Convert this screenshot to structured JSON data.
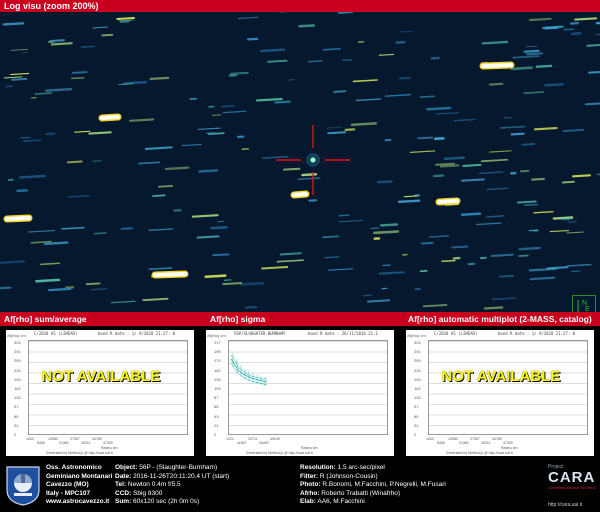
{
  "top_bar": {
    "title": "Log visu (zoom 200%)"
  },
  "compass": {
    "north_label": "N",
    "east_label": "E"
  },
  "panels": [
    {
      "title": "Af[rho] sum/average",
      "header": [
        "C/2018 A5 (LINEAR)",
        "band R  date : 1/ 9/2018 21:27: 0"
      ],
      "ylabel": "Af(rho) cm",
      "yticks": [
        "324",
        "291",
        "259",
        "226",
        "194",
        "162",
        "129",
        "97",
        "65",
        "32",
        "0"
      ],
      "xticks": [
        "1542",
        "8406",
        "15983",
        "21384",
        "27507",
        "34311",
        "40789",
        "47309"
      ],
      "xtitle": "Radius km",
      "generated": "Generated by Mefitrol(r) @ http://cara.uai.it",
      "status": "NOT AVAILABLE"
    },
    {
      "title": "Af[rho] sigma",
      "header": [
        "56P/SLAUGHTER-BURNHAM",
        "band R  date : 26/11/2016 21:1"
      ],
      "ylabel": "Af(rho) cm",
      "yticks": [
        "217",
        "195",
        "174",
        "152",
        "130",
        "109",
        "87",
        "65",
        "43",
        "22",
        "0"
      ],
      "xticks": [
        "1221",
        "11867",
        "29711",
        "34492",
        "49109"
      ],
      "xtitle": "Radius km",
      "generated": "Generated by Mefitrol(r) @ http://cara.uai.it",
      "status": ""
    },
    {
      "title": "Af[rho] automatic multiplot (2-MASS, catalog)",
      "header": [
        "C/2018 A5 (LINEAR)",
        "band R  date : 1/ 9/2018 21:27: 0"
      ],
      "ylabel": "Af(rho) cm",
      "yticks": [
        "324",
        "291",
        "259",
        "226",
        "194",
        "162",
        "129",
        "97",
        "65",
        "32",
        "0"
      ],
      "xticks": [
        "1542",
        "8406",
        "15983",
        "21384",
        "27507",
        "34311",
        "40789",
        "47309"
      ],
      "xtitle": "Radius km",
      "generated": "Generated by Mefitrol(r) @ http://cara.uai.it",
      "status": "NOT AVAILABLE"
    }
  ],
  "footer": {
    "observatory": [
      "Oss. Astronomico",
      "Geminiano Montanari",
      "Cavezzo (MO)",
      "Italy - MPC107",
      "www.astrocavezzo.it"
    ],
    "col2": [
      {
        "k": "Object:",
        "v": " 56P - (Slaughter-Burnham)"
      },
      {
        "k": "Date:",
        "v": " 2016-11-26T20:11:20.4 UT (start)"
      },
      {
        "k": "Tel:",
        "v": " Newton 0.4m f/5.5"
      },
      {
        "k": "CCD:",
        "v": " Sbig 8300"
      },
      {
        "k": "Sum:",
        "v": " 60x120 sec (2h 0m 0s)"
      }
    ],
    "col3": [
      {
        "k": "Resolution:",
        "v": " 1.5 arc-sec/pixel"
      },
      {
        "k": "Filter:",
        "v": " R (Johnson-Cousin)"
      },
      {
        "k": "Photo:",
        "v": " R.Bonomi, M.Facchini, P.Negrelli, M.Fusari"
      },
      {
        "k": "Afrho:",
        "v": " Roberto Trabatti (Winafrho)"
      },
      {
        "k": "Elab:",
        "v": " AA6, M.Facchini"
      }
    ],
    "cara_top": "Project",
    "cara_name": "CARA",
    "cara_sub": "Cometary Archive for Afrho",
    "cara_url": "http://cara.uai.it"
  }
}
